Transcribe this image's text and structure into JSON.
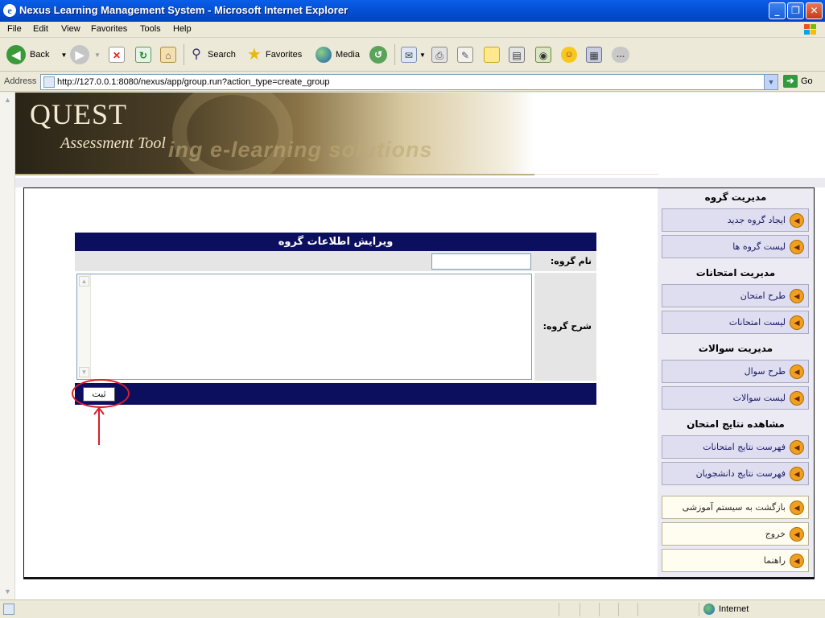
{
  "window": {
    "title": "Nexus Learning Management System - Microsoft Internet Explorer",
    "ie_icon_glyph": "e",
    "minimize_glyph": "_",
    "maximize_glyph": "❐",
    "close_glyph": "✕"
  },
  "menubar": [
    "File",
    "Edit",
    "View",
    "Favorites",
    "Tools",
    "Help"
  ],
  "toolbar": {
    "back": "Back",
    "search": "Search",
    "favorites": "Favorites",
    "media": "Media"
  },
  "address": {
    "label": "Address",
    "url": "http://127.0.0.1:8080/nexus/app/group.run?action_type=create_group",
    "go": "Go"
  },
  "banner": {
    "title": "QUEST",
    "subtitle": "Assessment Tool",
    "tagline": "ing e-learning solutions"
  },
  "form": {
    "heading": "ویرایش اطلاعات گروه",
    "name_label": "نام گروه:",
    "name_value": "",
    "description_label": "شرح گروه:",
    "description_value": "",
    "submit_label": "ثبت"
  },
  "side_menu": {
    "sections": [
      {
        "title": "مدیریت گروه",
        "items": [
          "ایجاد گروه جدید",
          "لیست گروه ها"
        ]
      },
      {
        "title": "مدیریت امتحانات",
        "items": [
          "طرح امتحان",
          "لیست امتحانات"
        ]
      },
      {
        "title": "مدیریت سوالات",
        "items": [
          "طرح سوال",
          "لیست سوالات"
        ]
      },
      {
        "title": "مشاهده نتایج امتحان",
        "items": [
          "فهرست نتایج امتحانات",
          "فهرست نتایج دانشجویان"
        ]
      }
    ],
    "bottom_items": [
      "بازگشت به سیستم آموزشی",
      "خروج",
      "راهنما"
    ]
  },
  "status": {
    "zone": "Internet"
  },
  "colors": {
    "form_header_bg": "#0b0f5e",
    "annotation_red": "#d8202a",
    "menu_item_icon": "#f0a020"
  }
}
